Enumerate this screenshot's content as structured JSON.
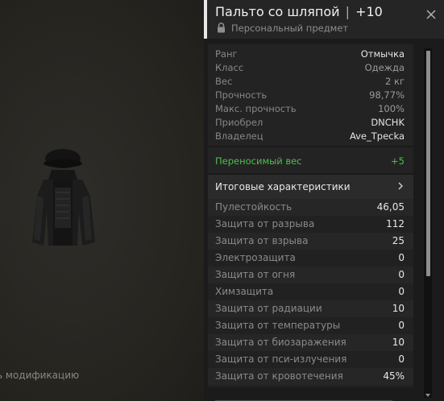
{
  "preview": {
    "mod_hint": "ь модификацию"
  },
  "item": {
    "title": "Пальто со шляпой",
    "separator": "|",
    "upgrade": "+10",
    "personal_label": "Персональный предмет"
  },
  "attributes": [
    {
      "label": "Ранг",
      "value": "Отмычка",
      "bright": true
    },
    {
      "label": "Класс",
      "value": "Одежда",
      "bright": false
    },
    {
      "label": "Вес",
      "value": "2 кг",
      "bright": false
    },
    {
      "label": "Прочность",
      "value": "98,77%",
      "bright": false
    },
    {
      "label": "Макс. прочность",
      "value": "100%",
      "bright": false
    },
    {
      "label": "Приобрел",
      "value": "DNCHK",
      "bright": true
    },
    {
      "label": "Владелец",
      "value": "Ave_Tpecka",
      "bright": true
    }
  ],
  "carry_weight": {
    "label": "Переносимый вес",
    "value": "+5"
  },
  "summary": {
    "label": "Итоговые характеристики"
  },
  "stats": [
    {
      "label": "Пулестойкость",
      "value": "46,05"
    },
    {
      "label": "Защита от разрыва",
      "value": "112"
    },
    {
      "label": "Защита от взрыва",
      "value": "25"
    },
    {
      "label": "Электрозащита",
      "value": "0"
    },
    {
      "label": "Защита от огня",
      "value": "0"
    },
    {
      "label": "Химзащита",
      "value": "0"
    },
    {
      "label": "Защита от радиации",
      "value": "10"
    },
    {
      "label": "Защита от температуры",
      "value": "0"
    },
    {
      "label": "Защита от биозаражения",
      "value": "10"
    },
    {
      "label": "Защита от пси-излучения",
      "value": "0"
    },
    {
      "label": "Защита от кровотечения",
      "value": "45%"
    }
  ],
  "colors": {
    "positive": "#4fbf4f",
    "panel_bg": "#1b1b1b",
    "header_accent": "#e8e8e8"
  },
  "icons": [
    "lock-icon",
    "close-icon",
    "chevron-right-icon",
    "scroll-down-icon"
  ]
}
